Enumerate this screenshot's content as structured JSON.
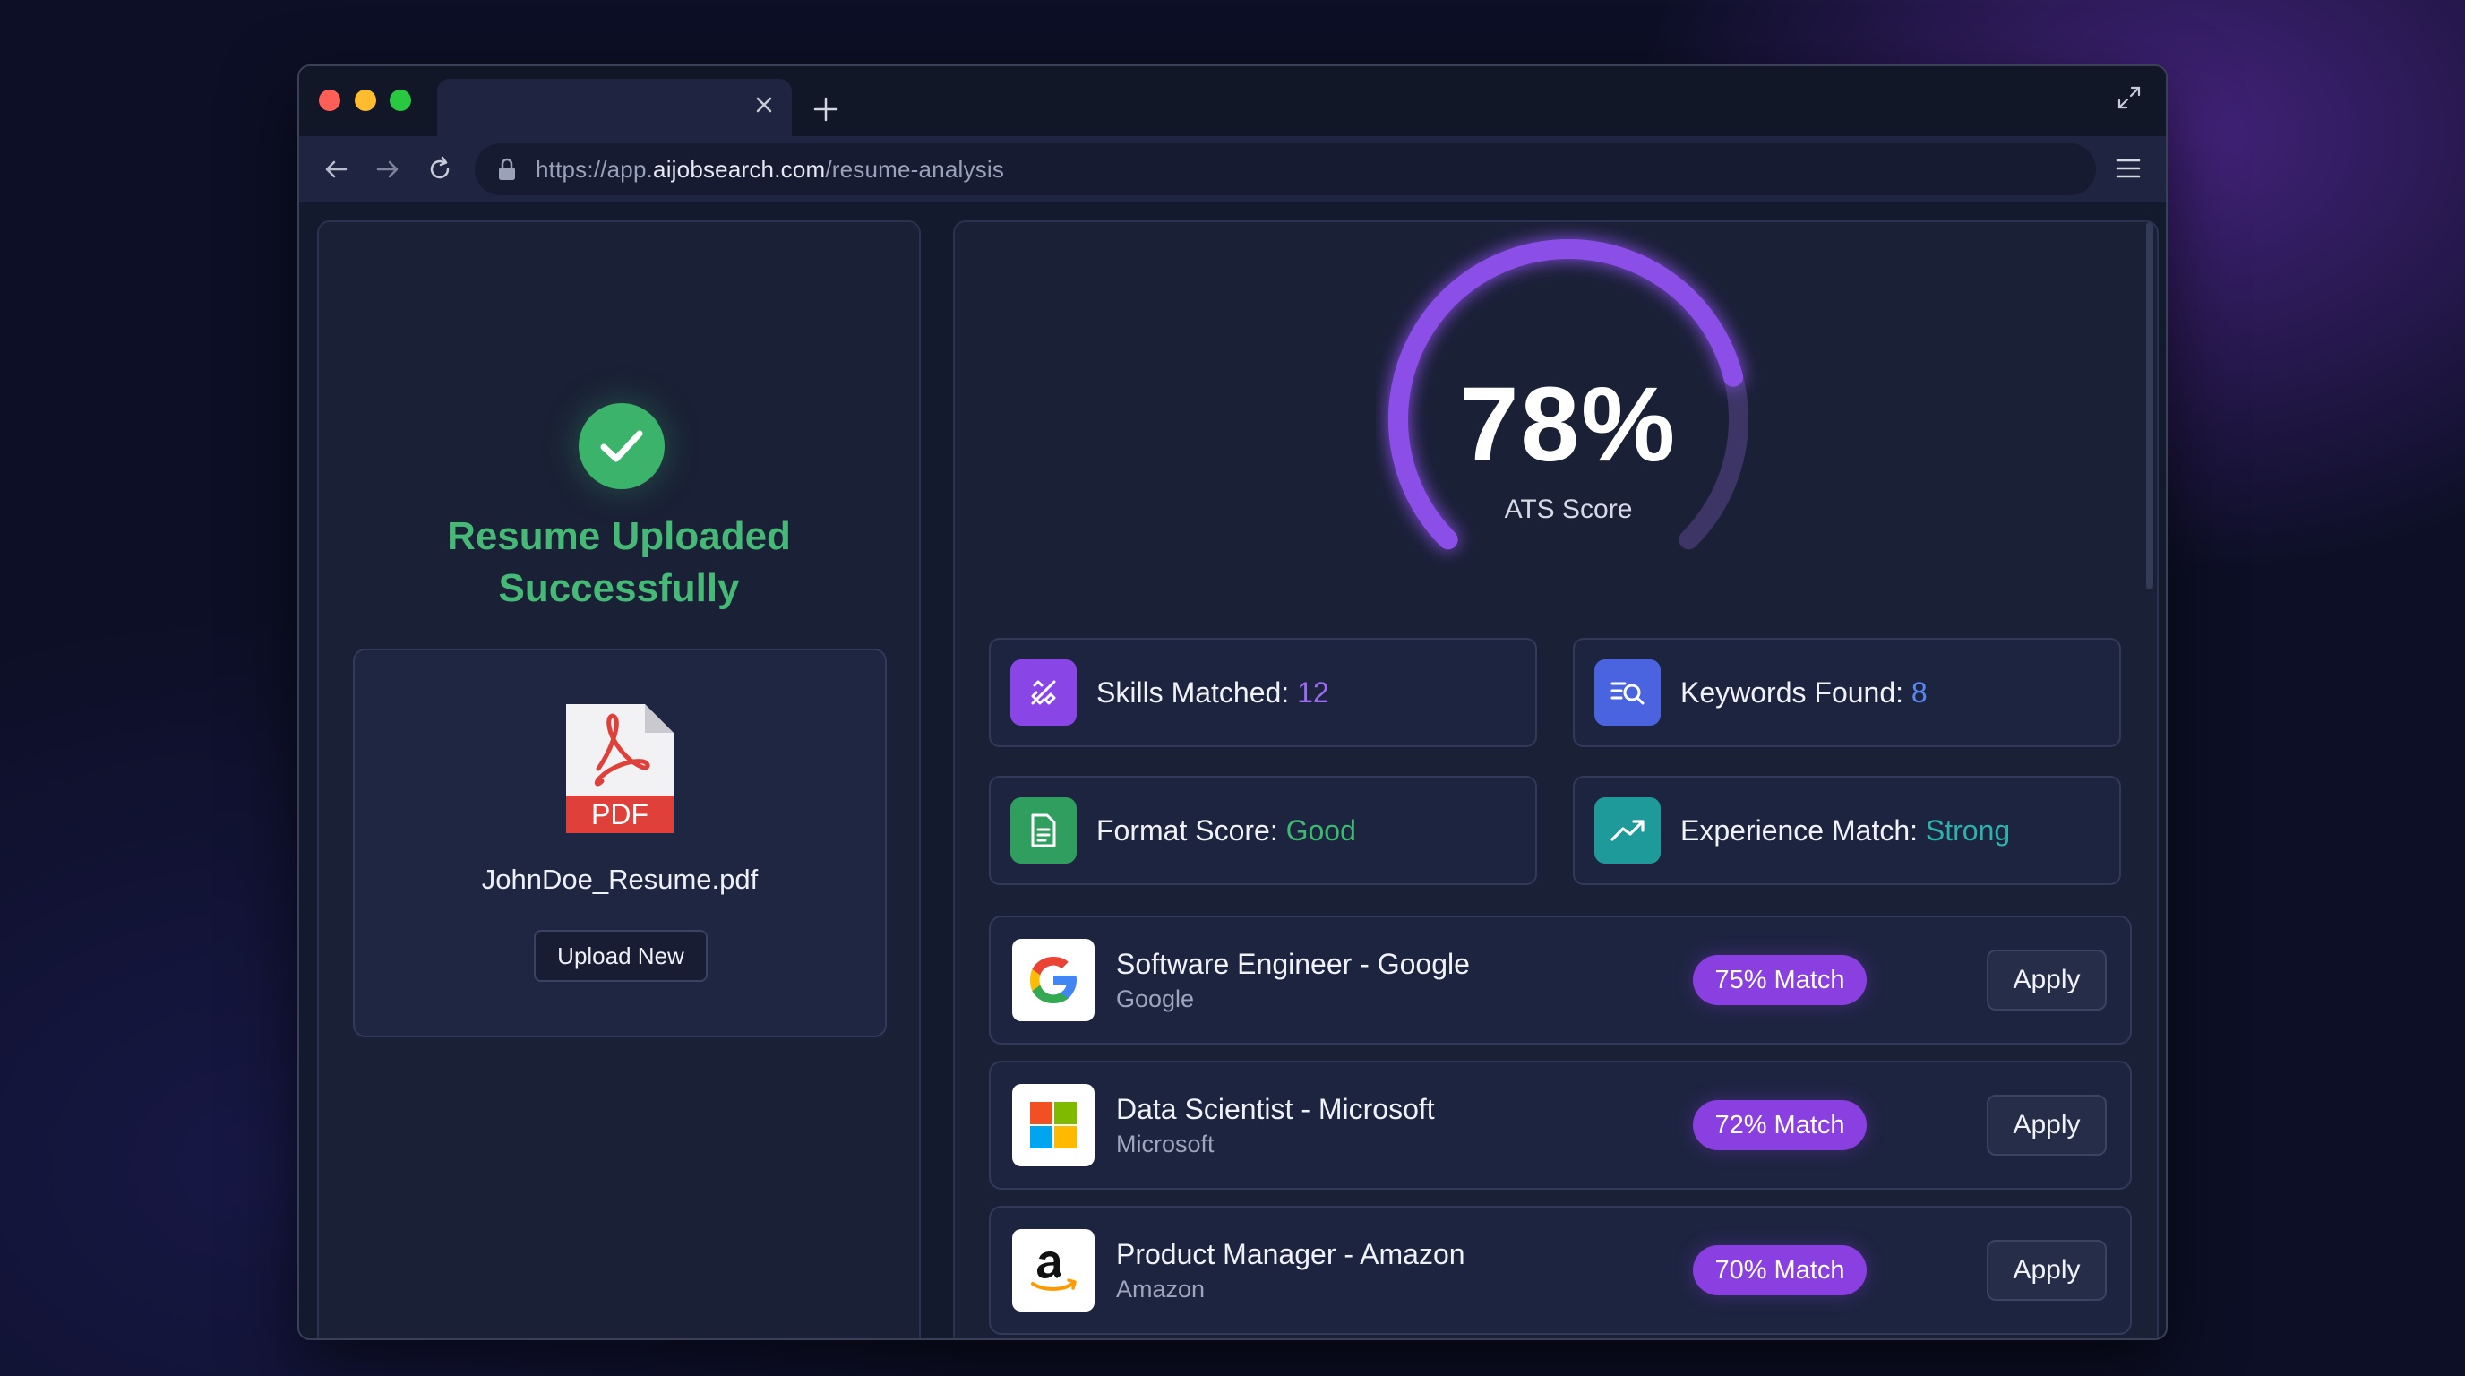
{
  "browser": {
    "url_prefix": "https://app.",
    "url_domain": "aijobsearch.com",
    "url_path": "/resume-analysis"
  },
  "upload": {
    "title_line1": "Resume Uploaded",
    "title_line2": "Successfully",
    "file_type": "PDF",
    "file_name": "JohnDoe_Resume.pdf",
    "upload_button": "Upload New"
  },
  "score": {
    "value": "78%",
    "fraction": 0.78,
    "label": "ATS Score"
  },
  "stats": [
    {
      "label": "Skills Matched: ",
      "value": "12",
      "value_color": "#9b6cf0",
      "icon_bg": "#8a45e6",
      "icon": "tools-icon"
    },
    {
      "label": "Keywords Found: ",
      "value": "8",
      "value_color": "#5a86f0",
      "icon_bg": "#4a64e0",
      "icon": "keyword-search-icon"
    },
    {
      "label": "Format Score: ",
      "value": "Good",
      "value_color": "#3fb872",
      "icon_bg": "#2f9e5e",
      "icon": "document-icon"
    },
    {
      "label": "Experience Match: ",
      "value": "Strong",
      "value_color": "#2fb0aa",
      "icon_bg": "#1f9a9a",
      "icon": "trend-up-icon"
    }
  ],
  "jobs": [
    {
      "title": "Software Engineer - Google",
      "company": "Google",
      "match": "75% Match",
      "apply": "Apply",
      "logo": "google-logo-icon"
    },
    {
      "title": "Data Scientist - Microsoft",
      "company": "Microsoft",
      "match": "72% Match",
      "apply": "Apply",
      "logo": "microsoft-logo-icon"
    },
    {
      "title": "Product Manager - Amazon",
      "company": "Amazon",
      "match": "70% Match",
      "apply": "Apply",
      "logo": "amazon-logo-icon"
    }
  ],
  "colors": {
    "accent": "#8a3fe0",
    "success": "#46b976"
  }
}
